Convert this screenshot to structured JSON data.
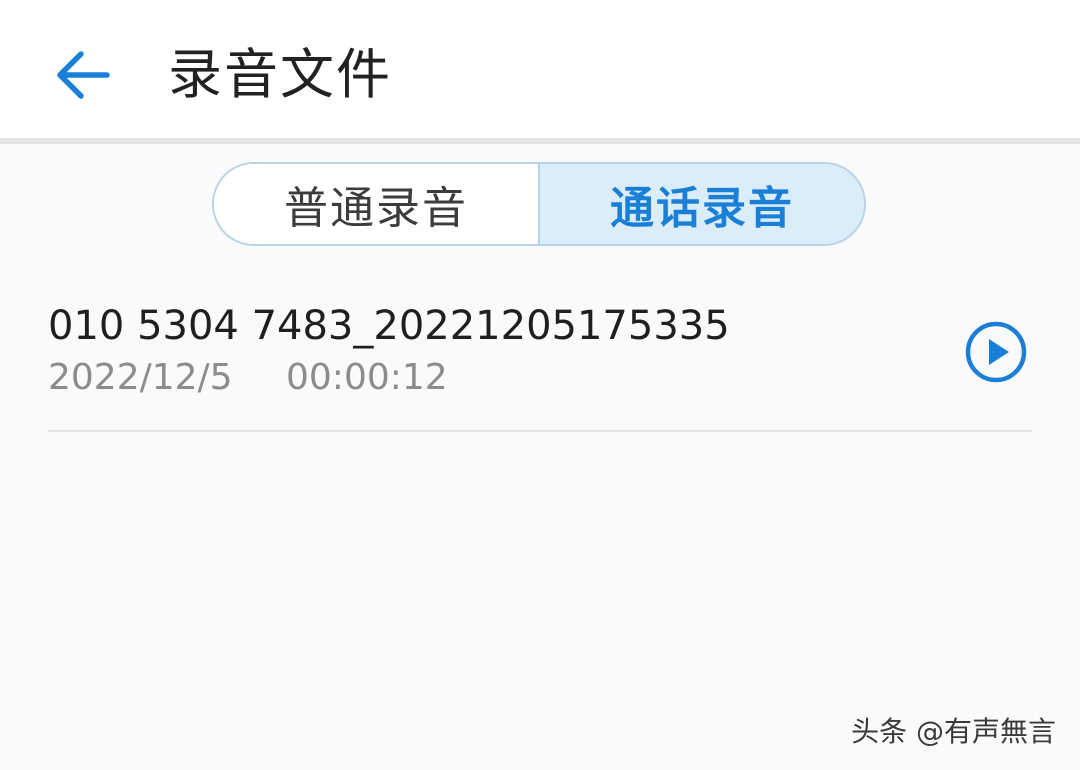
{
  "header": {
    "title": "录音文件",
    "back_icon": "arrow-left-icon"
  },
  "colors": {
    "accent": "#1a7fd6",
    "segment_active_bg": "#dcedfa",
    "segment_border": "#b7d3e6",
    "background": "#fafafc"
  },
  "tabs": [
    {
      "label": "普通录音",
      "selected": false
    },
    {
      "label": "通话录音",
      "selected": true
    }
  ],
  "recordings": [
    {
      "name": "010 5304 7483_20221205175335",
      "date": "2022/12/5",
      "duration": "00:00:12",
      "action_icon": "play-circle-icon"
    }
  ],
  "watermark": "头条 @有声無言"
}
